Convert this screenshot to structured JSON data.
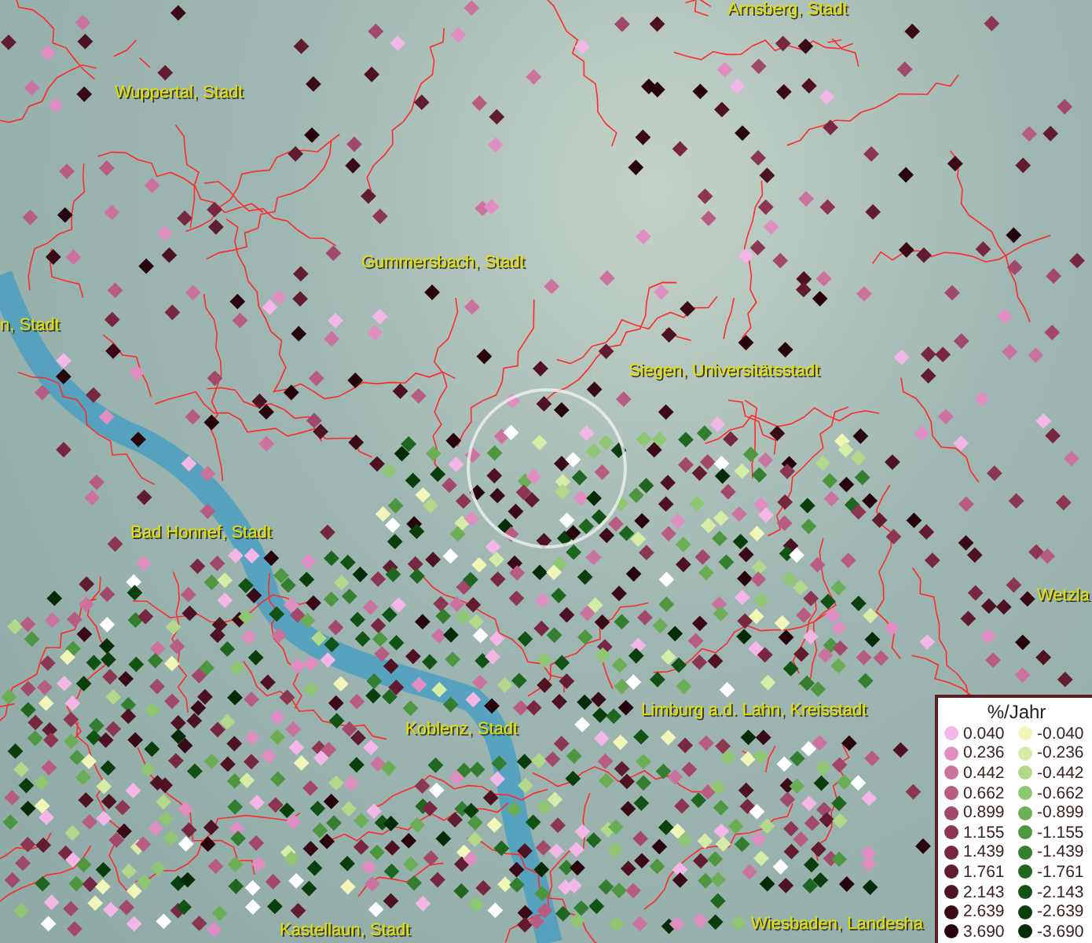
{
  "map": {
    "place_labels": [
      "Arnsberg, Stadt",
      "Wuppertal, Stadt",
      "Gummersbach, Stadt",
      "n, Stadt",
      "Siegen, Universitätsstadt",
      "Bad Honnef, Stadt",
      "Wetzla",
      "Limburg a.d. Lahn, Kreisstadt",
      "Koblenz, Stadt",
      "Wiesbaden, Landesha",
      "Kastellaun, Stadt"
    ]
  },
  "legend": {
    "title": "%/Jahr",
    "positive": [
      {
        "label": "0.040",
        "color": "#f4b6e6"
      },
      {
        "label": "0.236",
        "color": "#e08ec2"
      },
      {
        "label": "0.442",
        "color": "#cc729e"
      },
      {
        "label": "0.662",
        "color": "#b85c82"
      },
      {
        "label": "0.899",
        "color": "#a2486a"
      },
      {
        "label": "1.155",
        "color": "#8c3652"
      },
      {
        "label": "1.439",
        "color": "#772840"
      },
      {
        "label": "1.761",
        "color": "#621c30"
      },
      {
        "label": "2.143",
        "color": "#4e1222"
      },
      {
        "label": "2.639",
        "color": "#3a0a16"
      },
      {
        "label": "3.690",
        "color": "#28040c"
      }
    ],
    "negative": [
      {
        "label": "-0.040",
        "color": "#f0f5b8"
      },
      {
        "label": "-0.236",
        "color": "#d6eba6"
      },
      {
        "label": "-0.442",
        "color": "#b2d98a"
      },
      {
        "label": "-0.662",
        "color": "#8ec672"
      },
      {
        "label": "-0.899",
        "color": "#6cae56"
      },
      {
        "label": "-1.155",
        "color": "#4e9640"
      },
      {
        "label": "-1.439",
        "color": "#347e30"
      },
      {
        "label": "-1.761",
        "color": "#1f6620"
      },
      {
        "label": "-2.143",
        "color": "#135215"
      },
      {
        "label": "-2.639",
        "color": "#0a3e0c"
      },
      {
        "label": "-3.690",
        "color": "#052c08"
      }
    ]
  }
}
